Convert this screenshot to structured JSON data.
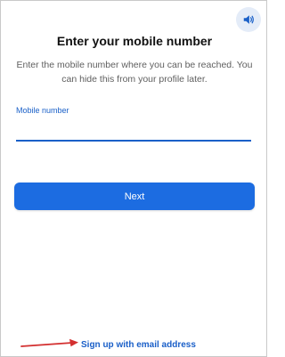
{
  "header": {
    "speaker_icon": "speaker-volume-icon"
  },
  "title": "Enter your mobile number",
  "description": "Enter the mobile number where you can be reached. You can hide this from your profile later.",
  "mobile_field": {
    "label": "Mobile number",
    "value": ""
  },
  "next_button": {
    "label": "Next"
  },
  "footer": {
    "email_link": "Sign up with email address",
    "arrow_icon": "red-arrow-icon"
  },
  "colors": {
    "accent": "#1c6ce1",
    "link": "#1a5fc8",
    "annotation_arrow": "#d32f2f"
  }
}
